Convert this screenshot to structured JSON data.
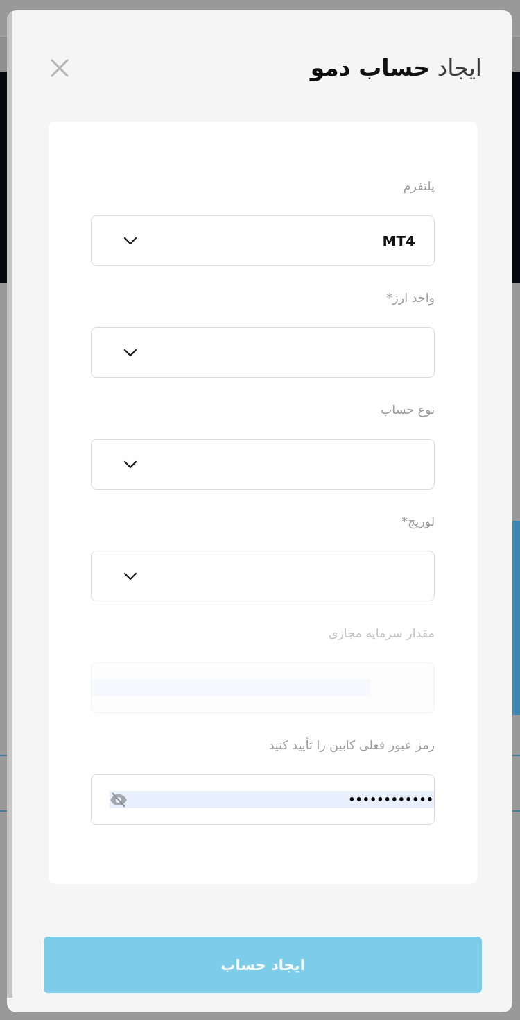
{
  "dialog": {
    "title": "ایجاد **حساب دمو**",
    "fields": [
      {
        "kind": "select",
        "label": "پلتفرم",
        "value": "MT4",
        "disabled": false
      },
      {
        "kind": "select",
        "label": "واحد ارز*",
        "disabled": false
      },
      {
        "kind": "select",
        "label": "نوع حساب",
        "disabled": false
      },
      {
        "kind": "select",
        "label": "لوریج*",
        "disabled": false
      },
      {
        "kind": "amount",
        "label": "مقدار سرمایه مجازی",
        "disabled": true
      },
      {
        "kind": "password",
        "label": "رمز عبور فعلی کابین را تأیید کنید",
        "value": "••••••••••••",
        "revealed": false,
        "disabled": false
      }
    ],
    "submit_button": {
      "label": "ایجاد حساب",
      "disabled": true
    }
  }
}
